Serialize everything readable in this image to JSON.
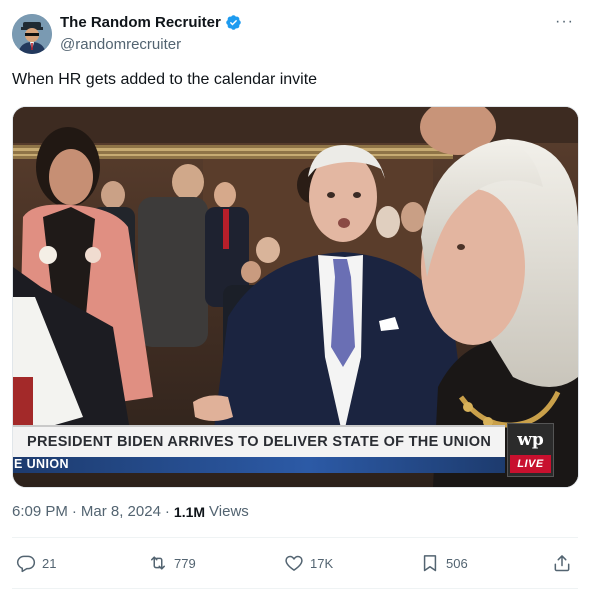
{
  "author": {
    "display_name": "The Random Recruiter",
    "handle": "@randomrecruiter",
    "verified_icon": "verified-badge-icon",
    "accent": "#1d9bf0"
  },
  "menu": {
    "more_label": "···"
  },
  "tweet": {
    "text": "When HR gets added to the calendar invite"
  },
  "media": {
    "chyron_headline": "PRESIDENT BIDEN ARRIVES TO DELIVER STATE OF THE UNION",
    "chyron_sub": "E UNION",
    "logo": "wp",
    "live_label": "LIVE"
  },
  "meta": {
    "time": "6:09 PM",
    "separator": "·",
    "date": "Mar 8, 2024",
    "views_count": "1.1M",
    "views_label": "Views"
  },
  "actions": {
    "replies": "21",
    "reposts": "779",
    "likes": "17K",
    "bookmarks": "506"
  }
}
